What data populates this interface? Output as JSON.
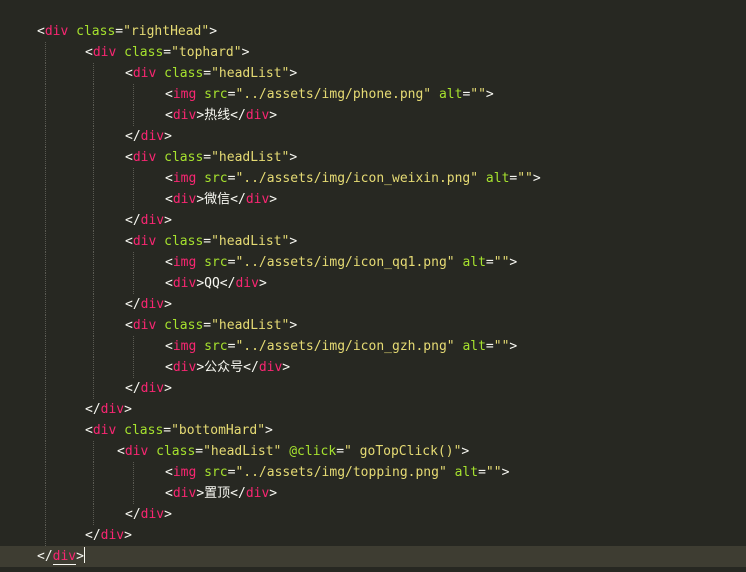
{
  "editor": {
    "theme": "Monokai",
    "colors": {
      "background": "#272822",
      "tag": "#f92672",
      "attribute": "#a6e22e",
      "string": "#e6db74",
      "text": "#f8f8f2",
      "current_line": "#3e3d32"
    },
    "lines": [
      [
        {
          "t": "punct",
          "v": "<"
        },
        {
          "t": "tag",
          "v": "div"
        },
        {
          "t": "punct",
          "v": " "
        },
        {
          "t": "attr",
          "v": "class"
        },
        {
          "t": "punct",
          "v": "="
        },
        {
          "t": "str",
          "v": "\"rightHead\""
        },
        {
          "t": "punct",
          "v": ">"
        }
      ],
      [
        {
          "t": "punct",
          "v": "<"
        },
        {
          "t": "tag",
          "v": "div"
        },
        {
          "t": "punct",
          "v": " "
        },
        {
          "t": "attr",
          "v": "class"
        },
        {
          "t": "punct",
          "v": "="
        },
        {
          "t": "str",
          "v": "\"tophard\""
        },
        {
          "t": "punct",
          "v": ">"
        }
      ],
      [
        {
          "t": "punct",
          "v": "<"
        },
        {
          "t": "tag",
          "v": "div"
        },
        {
          "t": "punct",
          "v": " "
        },
        {
          "t": "attr",
          "v": "class"
        },
        {
          "t": "punct",
          "v": "="
        },
        {
          "t": "str",
          "v": "\"headList\""
        },
        {
          "t": "punct",
          "v": ">"
        }
      ],
      [
        {
          "t": "punct",
          "v": "<"
        },
        {
          "t": "tag",
          "v": "img"
        },
        {
          "t": "punct",
          "v": " "
        },
        {
          "t": "attr",
          "v": "src"
        },
        {
          "t": "punct",
          "v": "="
        },
        {
          "t": "str",
          "v": "\"../assets/img/phone.png\""
        },
        {
          "t": "punct",
          "v": " "
        },
        {
          "t": "attr",
          "v": "alt"
        },
        {
          "t": "punct",
          "v": "="
        },
        {
          "t": "str",
          "v": "\"\""
        },
        {
          "t": "punct",
          "v": ">"
        }
      ],
      [
        {
          "t": "punct",
          "v": "<"
        },
        {
          "t": "tag",
          "v": "div"
        },
        {
          "t": "punct",
          "v": ">"
        },
        {
          "t": "text",
          "v": "热线"
        },
        {
          "t": "punct",
          "v": "</"
        },
        {
          "t": "tag",
          "v": "div"
        },
        {
          "t": "punct",
          "v": ">"
        }
      ],
      [
        {
          "t": "punct",
          "v": "</"
        },
        {
          "t": "tag",
          "v": "div"
        },
        {
          "t": "punct",
          "v": ">"
        }
      ],
      [
        {
          "t": "punct",
          "v": "<"
        },
        {
          "t": "tag",
          "v": "div"
        },
        {
          "t": "punct",
          "v": " "
        },
        {
          "t": "attr",
          "v": "class"
        },
        {
          "t": "punct",
          "v": "="
        },
        {
          "t": "str",
          "v": "\"headList\""
        },
        {
          "t": "punct",
          "v": ">"
        }
      ],
      [
        {
          "t": "punct",
          "v": "<"
        },
        {
          "t": "tag",
          "v": "img"
        },
        {
          "t": "punct",
          "v": " "
        },
        {
          "t": "attr",
          "v": "src"
        },
        {
          "t": "punct",
          "v": "="
        },
        {
          "t": "str",
          "v": "\"../assets/img/icon_weixin.png\""
        },
        {
          "t": "punct",
          "v": " "
        },
        {
          "t": "attr",
          "v": "alt"
        },
        {
          "t": "punct",
          "v": "="
        },
        {
          "t": "str",
          "v": "\"\""
        },
        {
          "t": "punct",
          "v": ">"
        }
      ],
      [
        {
          "t": "punct",
          "v": "<"
        },
        {
          "t": "tag",
          "v": "div"
        },
        {
          "t": "punct",
          "v": ">"
        },
        {
          "t": "text",
          "v": "微信"
        },
        {
          "t": "punct",
          "v": "</"
        },
        {
          "t": "tag",
          "v": "div"
        },
        {
          "t": "punct",
          "v": ">"
        }
      ],
      [
        {
          "t": "punct",
          "v": "</"
        },
        {
          "t": "tag",
          "v": "div"
        },
        {
          "t": "punct",
          "v": ">"
        }
      ],
      [
        {
          "t": "punct",
          "v": "<"
        },
        {
          "t": "tag",
          "v": "div"
        },
        {
          "t": "punct",
          "v": " "
        },
        {
          "t": "attr",
          "v": "class"
        },
        {
          "t": "punct",
          "v": "="
        },
        {
          "t": "str",
          "v": "\"headList\""
        },
        {
          "t": "punct",
          "v": ">"
        }
      ],
      [
        {
          "t": "punct",
          "v": "<"
        },
        {
          "t": "tag",
          "v": "img"
        },
        {
          "t": "punct",
          "v": " "
        },
        {
          "t": "attr",
          "v": "src"
        },
        {
          "t": "punct",
          "v": "="
        },
        {
          "t": "str",
          "v": "\"../assets/img/icon_qq1.png\""
        },
        {
          "t": "punct",
          "v": " "
        },
        {
          "t": "attr",
          "v": "alt"
        },
        {
          "t": "punct",
          "v": "="
        },
        {
          "t": "str",
          "v": "\"\""
        },
        {
          "t": "punct",
          "v": ">"
        }
      ],
      [
        {
          "t": "punct",
          "v": "<"
        },
        {
          "t": "tag",
          "v": "div"
        },
        {
          "t": "punct",
          "v": ">"
        },
        {
          "t": "text",
          "v": "QQ"
        },
        {
          "t": "punct",
          "v": "</"
        },
        {
          "t": "tag",
          "v": "div"
        },
        {
          "t": "punct",
          "v": ">"
        }
      ],
      [
        {
          "t": "punct",
          "v": "</"
        },
        {
          "t": "tag",
          "v": "div"
        },
        {
          "t": "punct",
          "v": ">"
        }
      ],
      [
        {
          "t": "punct",
          "v": "<"
        },
        {
          "t": "tag",
          "v": "div"
        },
        {
          "t": "punct",
          "v": " "
        },
        {
          "t": "attr",
          "v": "class"
        },
        {
          "t": "punct",
          "v": "="
        },
        {
          "t": "str",
          "v": "\"headList\""
        },
        {
          "t": "punct",
          "v": ">"
        }
      ],
      [
        {
          "t": "punct",
          "v": "<"
        },
        {
          "t": "tag",
          "v": "img"
        },
        {
          "t": "punct",
          "v": " "
        },
        {
          "t": "attr",
          "v": "src"
        },
        {
          "t": "punct",
          "v": "="
        },
        {
          "t": "str",
          "v": "\"../assets/img/icon_gzh.png\""
        },
        {
          "t": "punct",
          "v": " "
        },
        {
          "t": "attr",
          "v": "alt"
        },
        {
          "t": "punct",
          "v": "="
        },
        {
          "t": "str",
          "v": "\"\""
        },
        {
          "t": "punct",
          "v": ">"
        }
      ],
      [
        {
          "t": "punct",
          "v": "<"
        },
        {
          "t": "tag",
          "v": "div"
        },
        {
          "t": "punct",
          "v": ">"
        },
        {
          "t": "text",
          "v": "公众号"
        },
        {
          "t": "punct",
          "v": "</"
        },
        {
          "t": "tag",
          "v": "div"
        },
        {
          "t": "punct",
          "v": ">"
        }
      ],
      [
        {
          "t": "punct",
          "v": "</"
        },
        {
          "t": "tag",
          "v": "div"
        },
        {
          "t": "punct",
          "v": ">"
        }
      ],
      [
        {
          "t": "punct",
          "v": "</"
        },
        {
          "t": "tag",
          "v": "div"
        },
        {
          "t": "punct",
          "v": ">"
        }
      ],
      [
        {
          "t": "punct",
          "v": "<"
        },
        {
          "t": "tag",
          "v": "div"
        },
        {
          "t": "punct",
          "v": " "
        },
        {
          "t": "attr",
          "v": "class"
        },
        {
          "t": "punct",
          "v": "="
        },
        {
          "t": "str",
          "v": "\"bottomHard\""
        },
        {
          "t": "punct",
          "v": ">"
        }
      ],
      [
        {
          "t": "punct",
          "v": "<"
        },
        {
          "t": "tag",
          "v": "div"
        },
        {
          "t": "punct",
          "v": " "
        },
        {
          "t": "attr",
          "v": "class"
        },
        {
          "t": "punct",
          "v": "="
        },
        {
          "t": "str",
          "v": "\"headList\""
        },
        {
          "t": "punct",
          "v": " "
        },
        {
          "t": "attr",
          "v": "@click"
        },
        {
          "t": "punct",
          "v": "="
        },
        {
          "t": "str",
          "v": "\" goTopClick()\""
        },
        {
          "t": "punct",
          "v": ">"
        }
      ],
      [
        {
          "t": "punct",
          "v": "<"
        },
        {
          "t": "tag",
          "v": "img"
        },
        {
          "t": "punct",
          "v": " "
        },
        {
          "t": "attr",
          "v": "src"
        },
        {
          "t": "punct",
          "v": "="
        },
        {
          "t": "str",
          "v": "\"../assets/img/topping.png\""
        },
        {
          "t": "punct",
          "v": " "
        },
        {
          "t": "attr",
          "v": "alt"
        },
        {
          "t": "punct",
          "v": "="
        },
        {
          "t": "str",
          "v": "\"\""
        },
        {
          "t": "punct",
          "v": ">"
        }
      ],
      [
        {
          "t": "punct",
          "v": "<"
        },
        {
          "t": "tag",
          "v": "div"
        },
        {
          "t": "punct",
          "v": ">"
        },
        {
          "t": "text",
          "v": "置顶"
        },
        {
          "t": "punct",
          "v": "</"
        },
        {
          "t": "tag",
          "v": "div"
        },
        {
          "t": "punct",
          "v": ">"
        }
      ],
      [
        {
          "t": "punct",
          "v": "</"
        },
        {
          "t": "tag",
          "v": "div"
        },
        {
          "t": "punct",
          "v": ">"
        }
      ],
      [
        {
          "t": "punct",
          "v": "</"
        },
        {
          "t": "tag",
          "v": "div"
        },
        {
          "t": "punct",
          "v": ">"
        }
      ],
      [
        {
          "t": "punct",
          "v": "</"
        },
        {
          "t": "tag",
          "v": "div",
          "match": true
        },
        {
          "t": "punct",
          "v": ">"
        }
      ]
    ]
  }
}
